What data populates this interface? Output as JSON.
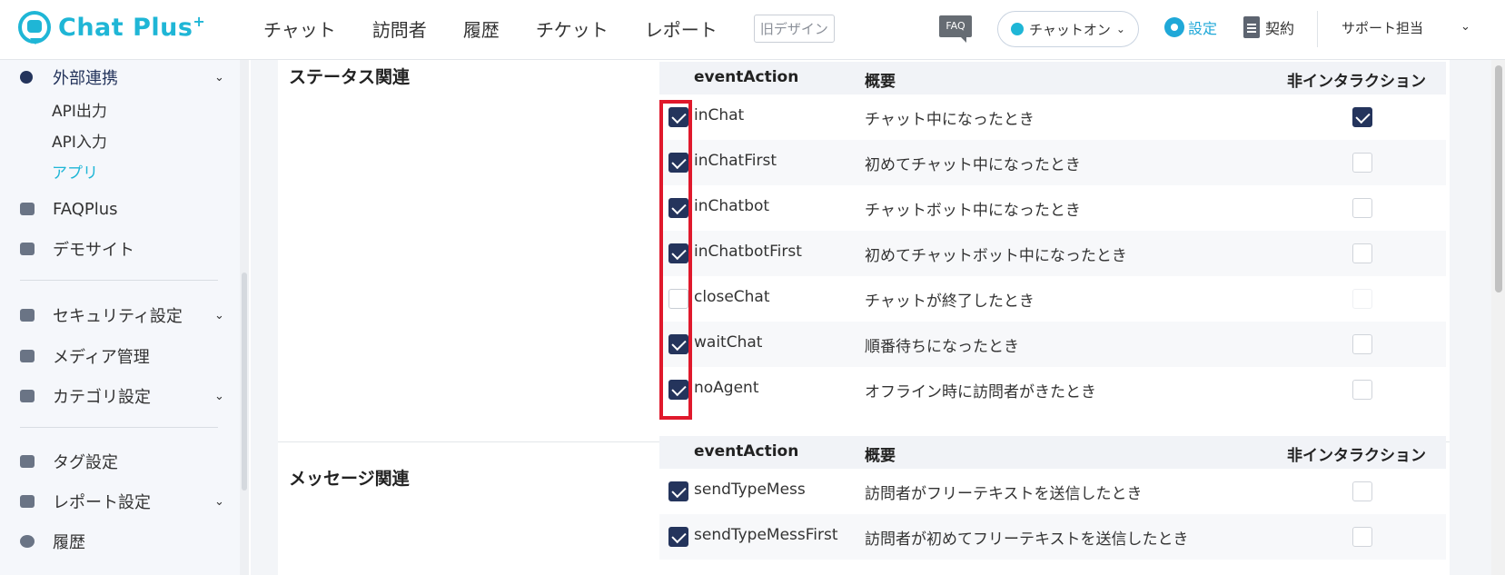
{
  "header": {
    "brand": "Chat Plus",
    "brand_plus": "+",
    "nav": [
      "チャット",
      "訪問者",
      "履歴",
      "チケット",
      "レポート"
    ],
    "old_design": "旧デザイン",
    "faq_badge": "FAQ",
    "status": "チャットオン",
    "settings": "設定",
    "contract": "契約",
    "user": "サポート担当"
  },
  "sidebar": {
    "external": "外部連携",
    "sub_items": [
      "API出力",
      "API入力",
      "アプリ"
    ],
    "active_sub": "アプリ",
    "items": [
      {
        "label": "FAQPlus",
        "icon": "shield-icon"
      },
      {
        "label": "デモサイト",
        "icon": "monitor-icon"
      },
      {
        "label": "セキュリティ設定",
        "icon": "lock-icon"
      },
      {
        "label": "メディア管理",
        "icon": "image-icon"
      },
      {
        "label": "カテゴリ設定",
        "icon": "folder-icon"
      },
      {
        "label": "タグ設定",
        "icon": "tag-icon"
      },
      {
        "label": "レポート設定",
        "icon": "bar-chart-icon"
      },
      {
        "label": "履歴",
        "icon": "clock-icon"
      }
    ]
  },
  "sections": [
    {
      "title": "ステータス関連",
      "headers": {
        "event": "eventAction",
        "summary": "概要",
        "noninteraction": "非インタラクション"
      },
      "rows": [
        {
          "event": "inChat",
          "summary": "チャット中になったとき",
          "checked": true,
          "noninteraction": true
        },
        {
          "event": "inChatFirst",
          "summary": "初めてチャット中になったとき",
          "checked": true,
          "noninteraction": false
        },
        {
          "event": "inChatbot",
          "summary": "チャットボット中になったとき",
          "checked": true,
          "noninteraction": false
        },
        {
          "event": "inChatbotFirst",
          "summary": "初めてチャットボット中になったとき",
          "checked": true,
          "noninteraction": false
        },
        {
          "event": "closeChat",
          "summary": "チャットが終了したとき",
          "checked": false,
          "noninteraction": false
        },
        {
          "event": "waitChat",
          "summary": "順番待ちになったとき",
          "checked": true,
          "noninteraction": false
        },
        {
          "event": "noAgent",
          "summary": "オフライン時に訪問者がきたとき",
          "checked": true,
          "noninteraction": false
        }
      ]
    },
    {
      "title": "メッセージ関連",
      "headers": {
        "event": "eventAction",
        "summary": "概要",
        "noninteraction": "非インタラクション"
      },
      "rows": [
        {
          "event": "sendTypeMess",
          "summary": "訪問者がフリーテキストを送信したとき",
          "checked": true,
          "noninteraction": false
        },
        {
          "event": "sendTypeMessFirst",
          "summary": "訪問者が初めてフリーテキストを送信したとき",
          "checked": true,
          "noninteraction": false
        }
      ]
    }
  ]
}
